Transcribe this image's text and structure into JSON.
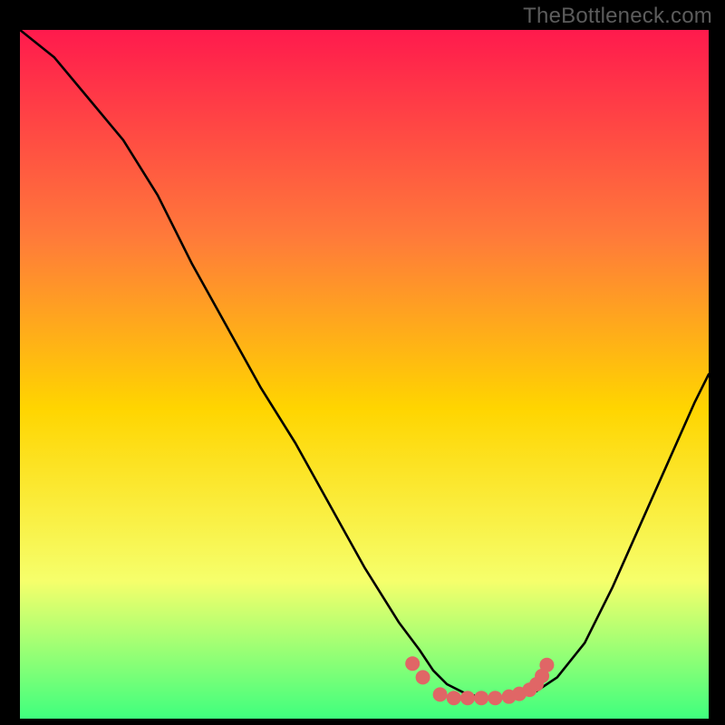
{
  "watermark": "TheBottleneck.com",
  "chart_data": {
    "type": "line",
    "title": "",
    "xlabel": "",
    "ylabel": "",
    "xlim": [
      0,
      100
    ],
    "ylim": [
      0,
      100
    ],
    "background_gradient": {
      "top": "#ff1a4d",
      "upper_mid": "#ff7a3a",
      "mid": "#ffd500",
      "lower_mid": "#f6ff6b",
      "bottom": "#3fff7e"
    },
    "series": [
      {
        "name": "bottleneck-curve",
        "stroke": "#000000",
        "x": [
          0,
          5,
          10,
          15,
          20,
          22,
          25,
          30,
          35,
          40,
          45,
          50,
          55,
          58,
          60,
          62,
          65,
          68,
          70,
          72,
          75,
          78,
          82,
          86,
          90,
          94,
          98,
          100
        ],
        "values": [
          100,
          96,
          90,
          84,
          76,
          72,
          66,
          57,
          48,
          40,
          31,
          22,
          14,
          10,
          7,
          5,
          3.5,
          3,
          3,
          3.2,
          4,
          6,
          11,
          19,
          28,
          37,
          46,
          50
        ]
      }
    ],
    "markers": {
      "name": "optimal-region-dots",
      "color": "#e06666",
      "radius_px": 8,
      "points": [
        {
          "x": 57,
          "y": 8
        },
        {
          "x": 58.5,
          "y": 6
        },
        {
          "x": 61,
          "y": 3.5
        },
        {
          "x": 63,
          "y": 3
        },
        {
          "x": 65,
          "y": 3
        },
        {
          "x": 67,
          "y": 3
        },
        {
          "x": 69,
          "y": 3
        },
        {
          "x": 71,
          "y": 3.2
        },
        {
          "x": 72.5,
          "y": 3.6
        },
        {
          "x": 74,
          "y": 4.2
        },
        {
          "x": 75,
          "y": 5
        },
        {
          "x": 75.8,
          "y": 6.2
        },
        {
          "x": 76.5,
          "y": 7.8
        }
      ]
    }
  }
}
